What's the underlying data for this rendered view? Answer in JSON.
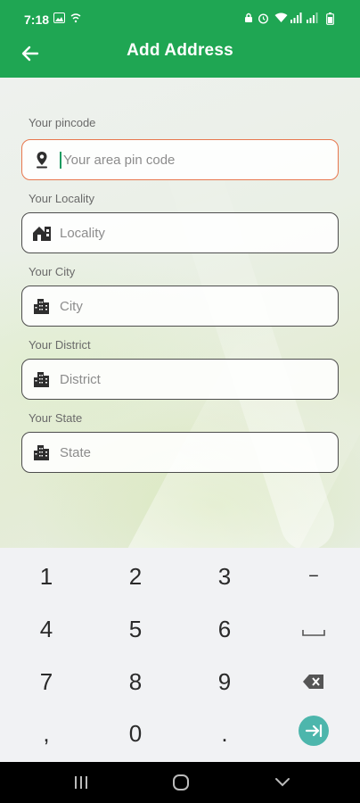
{
  "status_bar": {
    "time": "7:18"
  },
  "app_bar": {
    "title": "Add Address"
  },
  "form": {
    "pincode": {
      "label": "Your pincode",
      "placeholder": "Your area pin code",
      "value": ""
    },
    "locality": {
      "label": "Your Locality",
      "placeholder": "Locality",
      "value": ""
    },
    "city": {
      "label": "Your City",
      "placeholder": "City",
      "value": ""
    },
    "district": {
      "label": "Your District",
      "placeholder": "District",
      "value": ""
    },
    "state": {
      "label": "Your State",
      "placeholder": "State",
      "value": ""
    }
  },
  "keyboard": {
    "keys": [
      "1",
      "2",
      "3",
      "−",
      "4",
      "5",
      "6",
      "␣",
      "7",
      "8",
      "9",
      "⌫",
      ",",
      "0",
      ".",
      "⇥"
    ]
  },
  "colors": {
    "primary": "#1fa653",
    "focus_border": "#e8774e",
    "border": "#4d4d4d",
    "go_key": "#4db6ac"
  }
}
